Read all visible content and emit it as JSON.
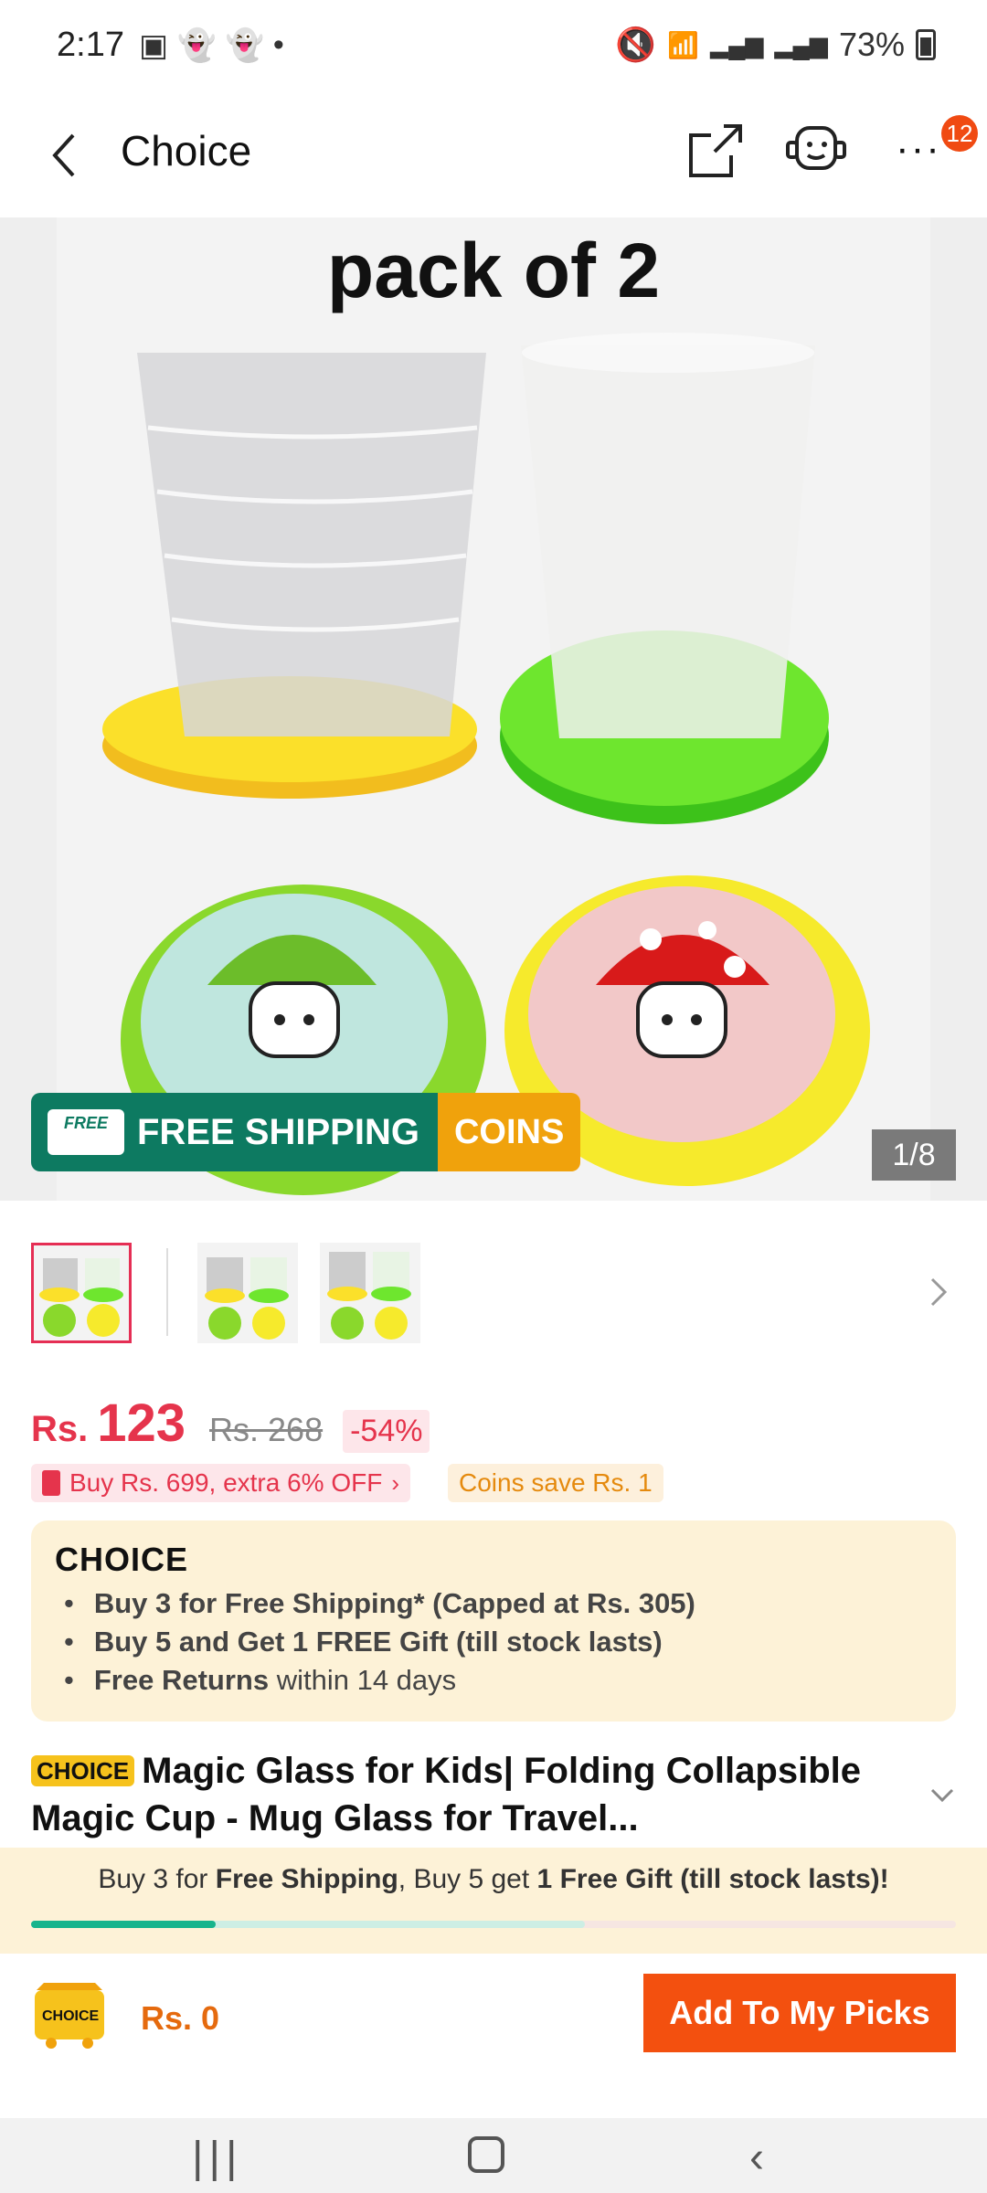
{
  "status_bar": {
    "time": "2:17",
    "battery": "73%"
  },
  "header": {
    "title": "Choice",
    "badge_count": "12"
  },
  "hero": {
    "image_text": "pack of 2",
    "free_shipping": "FREE SHIPPING",
    "truck_label": "FREE",
    "coins": "COINS",
    "counter": "1/8"
  },
  "price": {
    "currency": "Rs.",
    "amount": "123",
    "original": "Rs. 268",
    "discount": "-54%"
  },
  "promos": {
    "deal": "Buy Rs. 699, extra 6% OFF",
    "coins": "Coins save Rs. 1"
  },
  "choice_box": {
    "logo": "CHOICE",
    "items": [
      {
        "bold": "Buy 3 for  Free Shipping* (Capped at Rs. 305)",
        "rest": ""
      },
      {
        "bold": "Buy 5 and Get 1 FREE Gift (till stock lasts)",
        "rest": ""
      },
      {
        "bold": "Free Returns",
        "rest": " within 14 days"
      }
    ]
  },
  "product": {
    "tag": "CHOICE",
    "title": "Magic Glass for Kids| Folding Collapsible Magic Cup - Mug Glass for Travel..."
  },
  "bundle": {
    "p1": "Buy 3 for ",
    "b1": "Free Shipping",
    "p2": ", Buy 5 get ",
    "b2": "1 Free Gift (till stock lasts)!",
    "progress": 0.2
  },
  "action": {
    "cart_label": "CHOICE",
    "total": "Rs. 0",
    "add_button": "Add To My Picks"
  },
  "colors": {
    "accent": "#f3500f",
    "price": "#e5344c",
    "shipping": "#0d7a61",
    "coins": "#f0a20c",
    "choice_bg": "#fdf2d7"
  },
  "icons": [
    "back-arrow-icon",
    "share-icon",
    "support-bot-icon",
    "more-icon",
    "chevron-right-icon",
    "chevron-down-icon",
    "cart-icon"
  ]
}
